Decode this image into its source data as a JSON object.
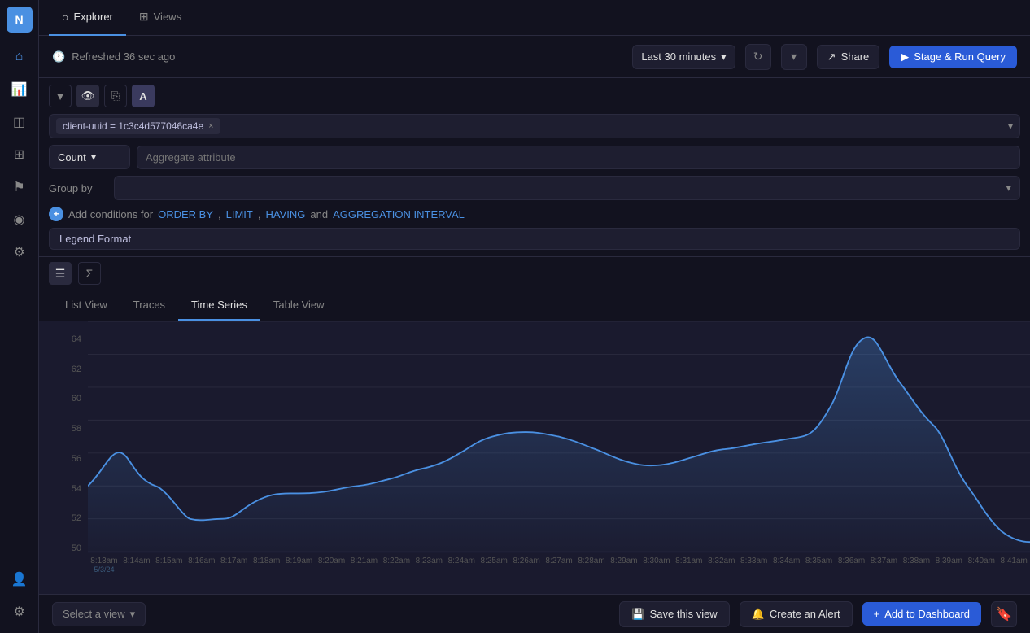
{
  "sidebar": {
    "logo": "N",
    "items": [
      {
        "name": "home",
        "icon": "⌂",
        "active": false
      },
      {
        "name": "chart",
        "icon": "📊",
        "active": true
      },
      {
        "name": "layers",
        "icon": "◫",
        "active": false
      },
      {
        "name": "grid",
        "icon": "⊞",
        "active": false
      },
      {
        "name": "flag",
        "icon": "⚑",
        "active": false
      },
      {
        "name": "eye",
        "icon": "◉",
        "active": false
      },
      {
        "name": "settings-alt",
        "icon": "⚙",
        "active": false
      }
    ],
    "bottom_items": [
      {
        "name": "people",
        "icon": "👤"
      },
      {
        "name": "settings",
        "icon": "⚙"
      }
    ]
  },
  "top_nav": {
    "tabs": [
      {
        "label": "Explorer",
        "icon": "○",
        "active": true
      },
      {
        "label": "Views",
        "icon": "⊞",
        "active": false
      }
    ]
  },
  "header": {
    "refresh_label": "Refreshed 36 sec ago",
    "refresh_icon": "🕐",
    "time_selector": {
      "label": "Last 30 minutes",
      "icon": "▾"
    },
    "refresh_btn": "↻",
    "more_btn": "▾",
    "share_label": "Share",
    "share_icon": "↗",
    "run_label": "Stage & Run Query",
    "run_icon": "▶"
  },
  "query": {
    "filter_tag": "client-uuid = 1c3c4d577046ca4e",
    "filter_close": "×",
    "aggregate": {
      "label": "Count",
      "placeholder": "Aggregate attribute"
    },
    "group_by": {
      "label": "Group by"
    },
    "conditions": {
      "plus": "+",
      "prefix": "Add conditions for",
      "links": [
        {
          "text": "ORDER BY",
          "href": "#"
        },
        {
          "text": "LIMIT",
          "href": "#"
        },
        {
          "text": "HAVING",
          "href": "#"
        },
        {
          "text": "AGGREGATION INTERVAL",
          "href": "#"
        }
      ],
      "separators": [
        ",",
        ",",
        "and"
      ]
    },
    "legend_format": "Legend Format"
  },
  "result_toolbar": {
    "table_icon": "☰",
    "sigma_icon": "Σ"
  },
  "view_tabs": [
    {
      "label": "List View",
      "active": false
    },
    {
      "label": "Traces",
      "active": false
    },
    {
      "label": "Time Series",
      "active": true
    },
    {
      "label": "Table View",
      "active": false
    }
  ],
  "chart": {
    "y_axis": [
      "64",
      "62",
      "60",
      "58",
      "56",
      "54",
      "52",
      "50"
    ],
    "x_labels": [
      "8:13am",
      "8:14am",
      "8:15am",
      "8:16am",
      "8:17am",
      "8:18am",
      "8:19am",
      "8:20am",
      "8:21am",
      "8:22am",
      "8:23am",
      "8:24am",
      "8:25am",
      "8:26am",
      "8:27am",
      "8:28am",
      "8:29am",
      "8:30am",
      "8:31am",
      "8:32am",
      "8:33am",
      "8:34am",
      "8:35am",
      "8:36am",
      "8:37am",
      "8:38am",
      "8:39am",
      "8:40am",
      "8:41am"
    ],
    "date_label": "5/3/24",
    "line_color": "#4a90e2",
    "fill_color": "rgba(74,144,226,0.15)"
  },
  "bottom_bar": {
    "select_view": "Select a view",
    "select_icon": "▾",
    "save_icon": "💾",
    "save_label": "Save this view",
    "alert_icon": "🔔",
    "alert_label": "Create an Alert",
    "dashboard_icon": "+",
    "dashboard_label": "Add to Dashboard",
    "bookmark_icon": "🔖"
  }
}
